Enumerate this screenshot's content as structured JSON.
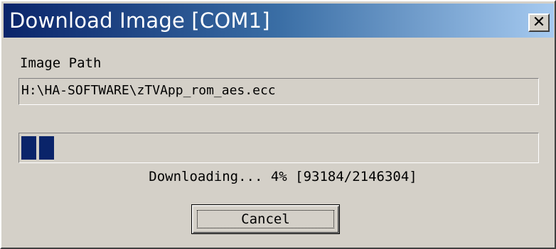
{
  "window": {
    "title": "Download Image [COM1]",
    "close_icon": "close-icon",
    "close_symbol": "✕"
  },
  "image_path": {
    "label": "Image Path",
    "value": "H:\\HA-SOFTWARE\\zTVApp_rom_aes.ecc"
  },
  "progress": {
    "percent": 4,
    "blocks_filled": 2,
    "fill_color": "#0a246a",
    "status_text": "Downloading... 4% [93184/2146304]"
  },
  "buttons": {
    "cancel_label": "Cancel"
  },
  "colors": {
    "title_start": "#0a246a",
    "title_end": "#a6caf0",
    "face": "#d4d0c8"
  }
}
